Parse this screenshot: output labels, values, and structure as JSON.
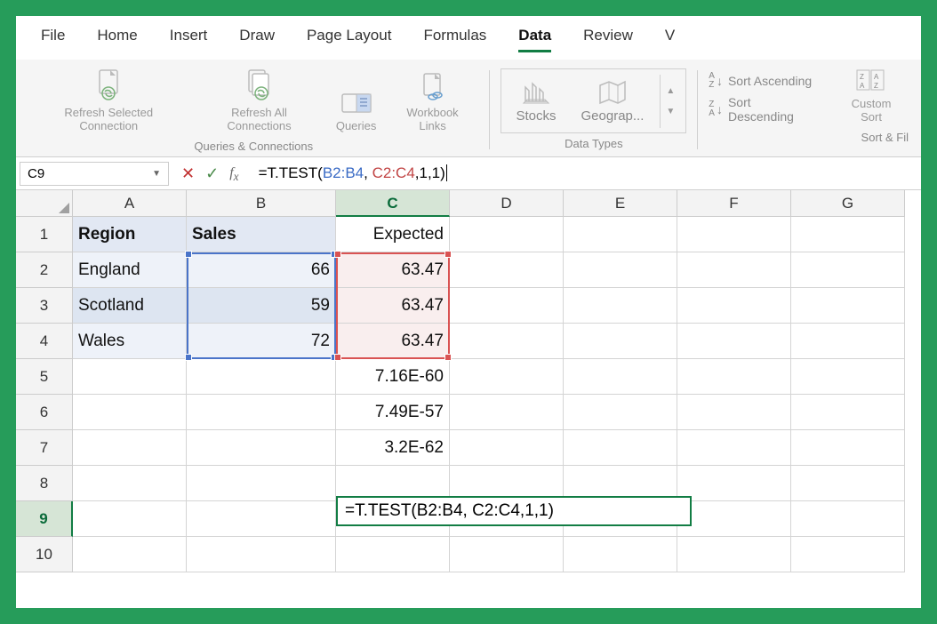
{
  "tabs": [
    "File",
    "Home",
    "Insert",
    "Draw",
    "Page Layout",
    "Formulas",
    "Data",
    "Review",
    "V"
  ],
  "active_tab": "Data",
  "ribbon": {
    "group1": {
      "label": "Queries & Connections",
      "btns": [
        "Refresh Selected Connection",
        "Refresh All Connections",
        "Queries",
        "Workbook Links"
      ]
    },
    "group2": {
      "label": "Data Types",
      "btns": [
        "Stocks",
        "Geograp..."
      ]
    },
    "group3": {
      "label": "Sort & Fil",
      "sort_asc": "Sort Ascending",
      "sort_desc": "Sort Descending",
      "custom": "Custom Sort"
    }
  },
  "namebox": "C9",
  "formula_prefix": "=T.TEST(",
  "formula_r1": "B2:B4",
  "formula_sep1": ", ",
  "formula_r2": "C2:C4",
  "formula_suffix": ",1,1)",
  "columns": [
    "A",
    "B",
    "C",
    "D",
    "E",
    "F",
    "G"
  ],
  "rows": [
    "1",
    "2",
    "3",
    "4",
    "5",
    "6",
    "7",
    "8",
    "9",
    "10"
  ],
  "cells": {
    "A1": "Region",
    "B1": "Sales",
    "C1": "Expected",
    "A2": "England",
    "B2": "66",
    "C2": "63.47",
    "A3": "Scotland",
    "B3": "59",
    "C3": "63.47",
    "A4": "Wales",
    "B4": "72",
    "C4": "63.47",
    "C5": "7.16E-60",
    "C6": "7.49E-57",
    "C7": "3.2E-62",
    "C9": "=T.TEST(B2:B4, C2:C4,1,1)"
  }
}
